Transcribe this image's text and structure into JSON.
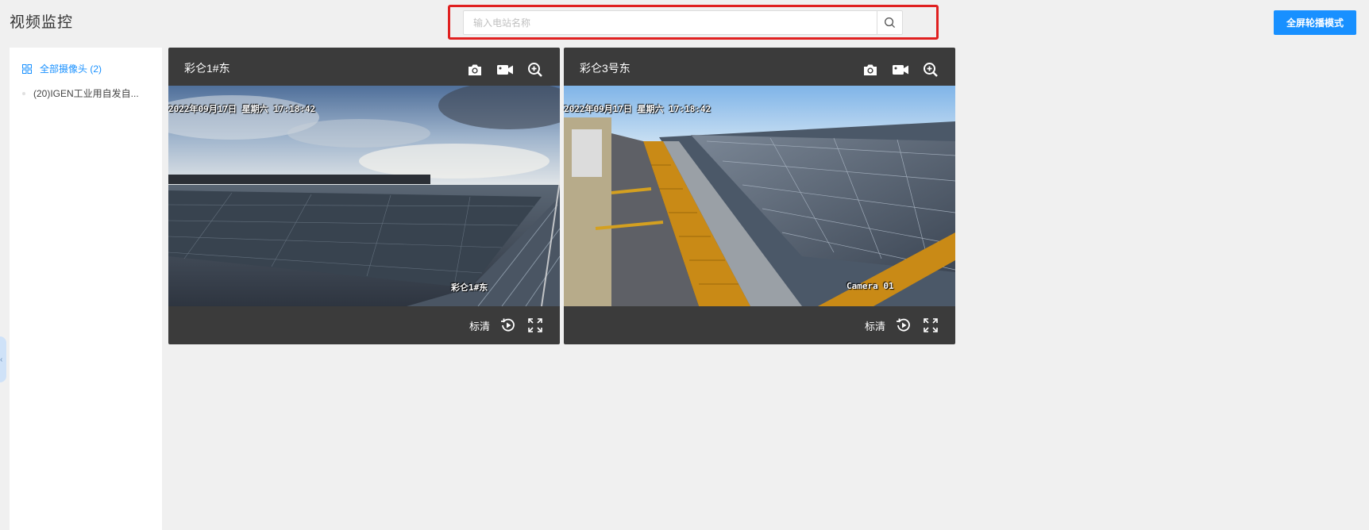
{
  "page": {
    "title": "视频监控"
  },
  "search": {
    "placeholder": "输入电站名称",
    "value": ""
  },
  "header": {
    "fullscreen_mode_label": "全屏轮播模式"
  },
  "sidebar": {
    "root_label": "全部摄像头 (2)",
    "items": [
      {
        "label": "(20)IGEN工业用自发自..."
      }
    ]
  },
  "cameras": [
    {
      "title": "彩仑1#东",
      "osd_time": "2022年09月17日  星期六  17:18:42",
      "osd_name": "彩仑1#东",
      "quality_label": "标清"
    },
    {
      "title": "彩仑3号东",
      "osd_time": "2022年09月17日  星期六  17:18:42",
      "osd_name": "Camera 01",
      "quality_label": "标清"
    }
  ],
  "colors": {
    "accent": "#1890ff",
    "highlight": "#e02020",
    "card_bg": "#3b3b3b"
  },
  "icons": {
    "tools": [
      "camera-icon",
      "video-record-icon",
      "zoom-in-icon"
    ],
    "footer": [
      "playback-icon",
      "fullscreen-icon"
    ]
  }
}
